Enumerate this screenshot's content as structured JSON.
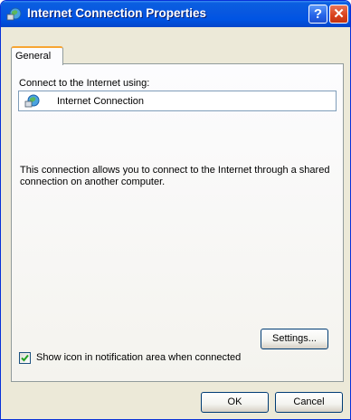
{
  "window": {
    "title": "Internet Connection Properties",
    "help_symbol": "?",
    "close_symbol": "✕"
  },
  "tabs": [
    {
      "label": "General"
    }
  ],
  "connect_label": "Connect to the Internet using:",
  "connection_name": "Internet Connection",
  "description": "This connection allows you to connect to the Internet through a shared connection on another computer.",
  "settings_button": "Settings...",
  "show_icon_checkbox": {
    "label": "Show icon in notification area when connected",
    "checked": true
  },
  "buttons": {
    "ok": "OK",
    "cancel": "Cancel"
  },
  "icons": {
    "title": "network-connection-icon",
    "connection": "internet-connection-icon"
  }
}
